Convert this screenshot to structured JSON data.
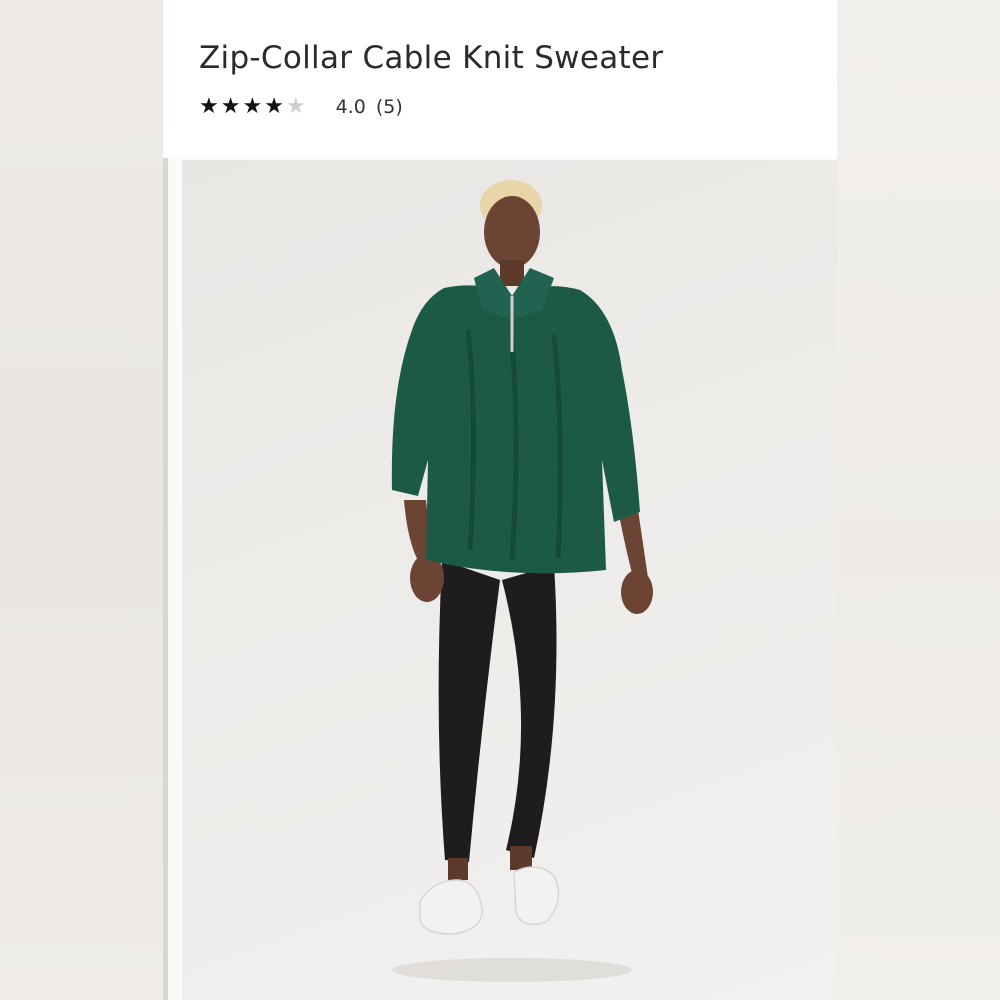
{
  "product": {
    "title": "Zip-Collar Cable Knit Sweater",
    "rating": {
      "stars_filled": 4,
      "stars_total": 5,
      "value_text": "4.0",
      "count_text": "(5)"
    },
    "image": {
      "alt_subject": "model wearing green zip-collar cable knit sweater with black leggings and white sneakers"
    }
  },
  "colors": {
    "sweater": "#1c5a45",
    "leggings": "#1e1c1d",
    "sneakers": "#f2f2f2",
    "skin": "#6b4433",
    "hair": "#e8d6a8",
    "star_filled": "#111111",
    "star_empty": "#cfcfcf"
  }
}
